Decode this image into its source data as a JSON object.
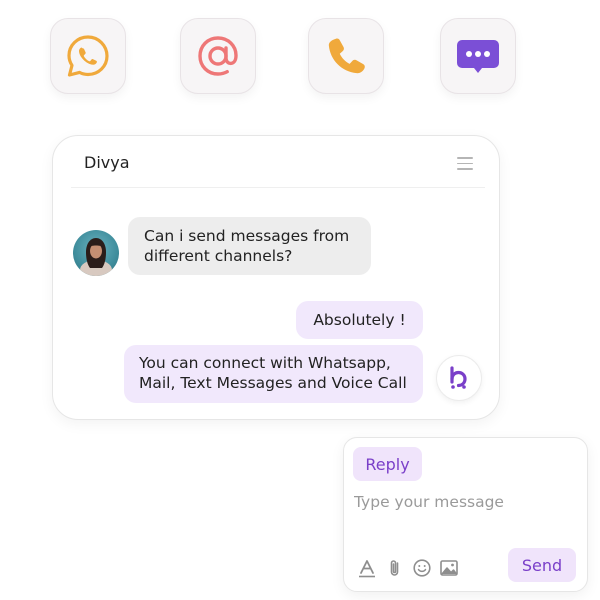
{
  "channels": [
    {
      "name": "whatsapp-icon",
      "color": "#f0a93b"
    },
    {
      "name": "email-icon",
      "color": "#ee7777"
    },
    {
      "name": "phone-icon",
      "color": "#f0a93b"
    },
    {
      "name": "sms-icon",
      "color": "#7b4fd6"
    }
  ],
  "chat": {
    "contact_name": "Divya",
    "messages": [
      {
        "from": "user",
        "text": "Can i send messages from different channels?"
      },
      {
        "from": "bot",
        "text": "Absolutely !"
      },
      {
        "from": "bot",
        "text": "You can connect with Whatsapp, Mail, Text Messages and Voice Call"
      }
    ]
  },
  "composer": {
    "tab_label": "Reply",
    "placeholder": "Type your message",
    "send_label": "Send",
    "tools": [
      "text-format-icon",
      "attachment-icon",
      "emoji-icon",
      "image-icon"
    ]
  },
  "colors": {
    "accent": "#7a3fc9",
    "accent_light": "#f0e4fb",
    "bubble_in": "#ededed",
    "bubble_out": "#f1e8fc"
  }
}
